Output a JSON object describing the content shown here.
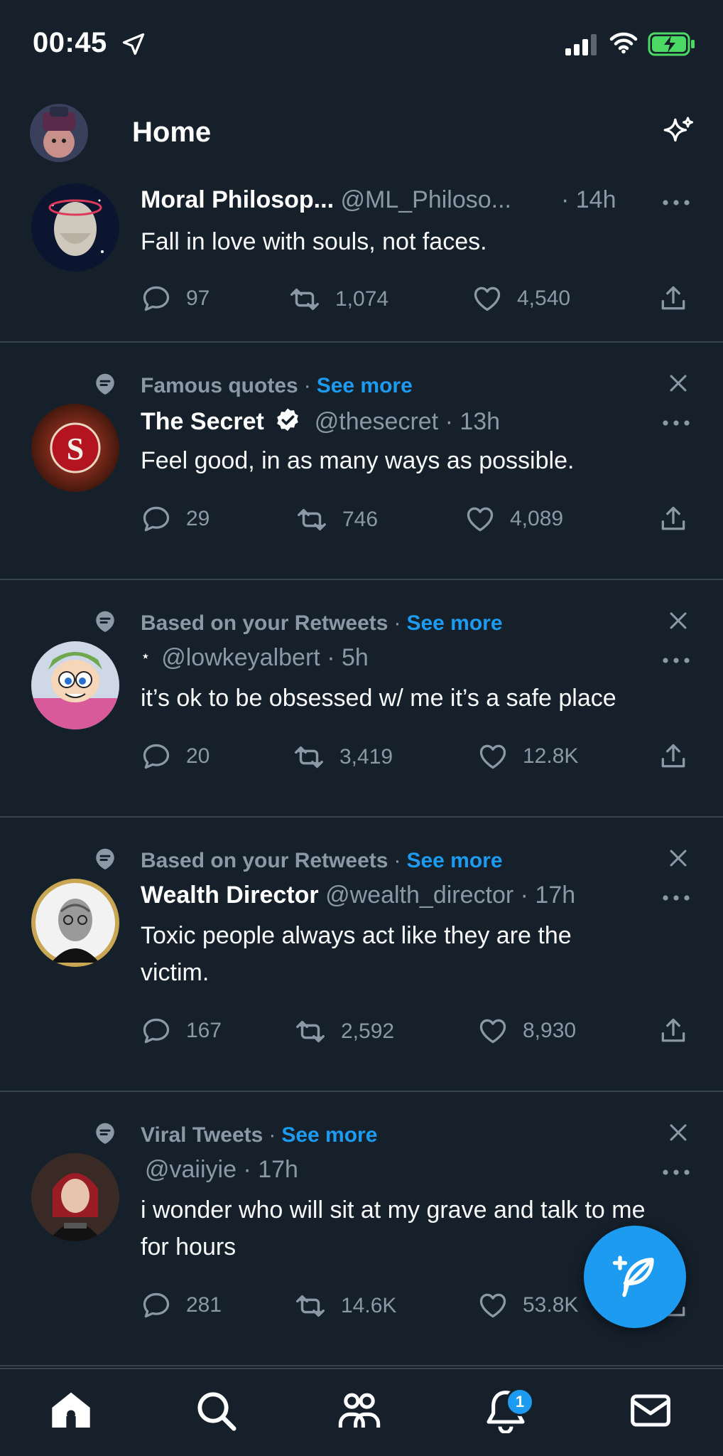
{
  "status_bar": {
    "time": "00:45"
  },
  "header": {
    "title": "Home"
  },
  "tweets": [
    {
      "name": "Moral Philosop...",
      "handle": "@ML_Philoso...",
      "time": "· 14h",
      "text": "Fall in love with souls, not faces.",
      "replies": "97",
      "retweets": "1,074",
      "likes": "4,540"
    },
    {
      "context": "Famous quotes",
      "see_more": "See more",
      "name": "The Secret",
      "handle": "@thesecret",
      "time": "· 13h",
      "text": "Feel good, in as many ways as possible.",
      "replies": "29",
      "retweets": "746",
      "likes": "4,089"
    },
    {
      "context": "Based on your Retweets",
      "see_more": "See more",
      "name": "⋆",
      "handle": "@lowkeyalbert",
      "time": "· 5h",
      "text": "it’s ok to be obsessed w/ me it’s a safe place",
      "replies": "20",
      "retweets": "3,419",
      "likes": "12.8K"
    },
    {
      "context": "Based on your Retweets",
      "see_more": "See more",
      "name": "Wealth Director",
      "handle": "@wealth_director",
      "time": "· 17h",
      "text": "Toxic people always act like they are the victim.",
      "replies": "167",
      "retweets": "2,592",
      "likes": "8,930"
    },
    {
      "context": "Viral Tweets",
      "see_more": "See more",
      "name": "",
      "handle": "@vaiiyie",
      "time": "· 17h",
      "text": "i wonder who will sit at my grave and talk to me for hours",
      "replies": "281",
      "retweets": "14.6K",
      "likes": "53.8K"
    }
  ],
  "tabbar": {
    "notifications_badge": "1"
  },
  "colors": {
    "background": "#15202b",
    "accent": "#1d9bf0",
    "muted": "#8b98a5",
    "divider": "#38444d",
    "battery": "#4cd964"
  },
  "icons": [
    "location-arrow-icon",
    "signal-icon",
    "wifi-icon",
    "battery-charging-icon",
    "sparkle-icon",
    "more-icon",
    "reply-icon",
    "retweet-icon",
    "like-icon",
    "share-icon",
    "topic-icon",
    "close-icon",
    "verified-icon",
    "compose-icon",
    "home-icon",
    "search-icon",
    "communities-icon",
    "bell-icon",
    "mail-icon"
  ]
}
